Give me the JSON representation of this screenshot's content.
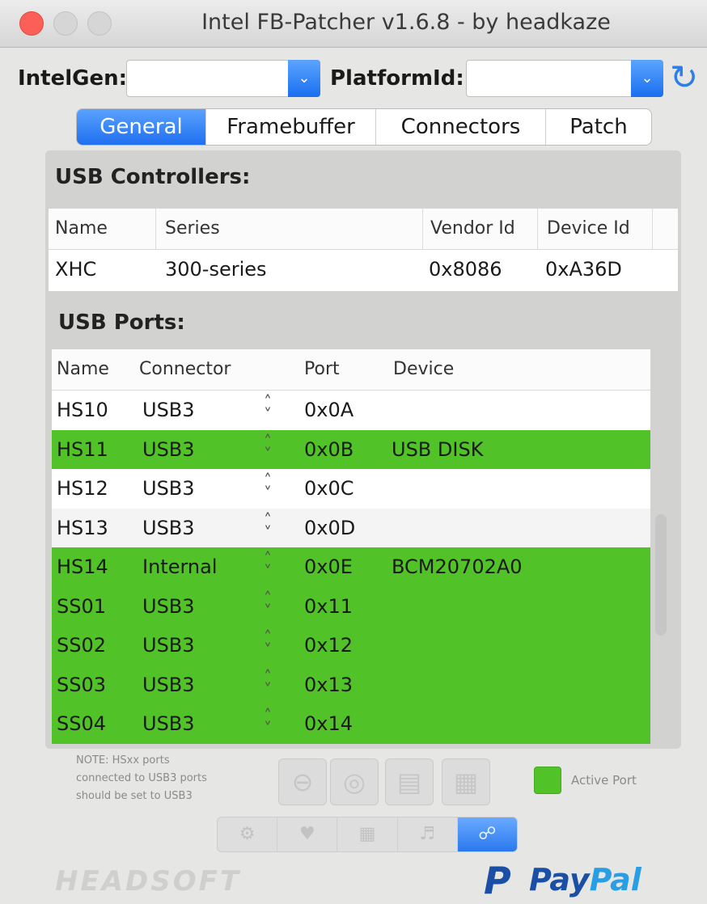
{
  "window": {
    "title": "Intel FB-Patcher v1.6.8 - by headkaze"
  },
  "toolbar_top": {
    "intelgen_label": "IntelGen:",
    "intelgen_value": "",
    "platformid_label": "PlatformId:",
    "platformid_value": ""
  },
  "tabs": [
    {
      "label": "General",
      "active": true
    },
    {
      "label": "Framebuffer",
      "active": false
    },
    {
      "label": "Connectors",
      "active": false
    },
    {
      "label": "Patch",
      "active": false
    }
  ],
  "usb_controllers": {
    "title": "USB Controllers:",
    "columns": [
      "Name",
      "Series",
      "Vendor Id",
      "Device Id"
    ],
    "rows": [
      {
        "name": "XHC",
        "series": "300-series",
        "vendor_id": "0x8086",
        "device_id": "0xA36D"
      }
    ]
  },
  "usb_ports": {
    "title": "USB Ports:",
    "columns": [
      "Name",
      "Connector",
      "Port",
      "Device"
    ],
    "rows": [
      {
        "name": "HS10",
        "connector": "USB3",
        "port": "0x0A",
        "device": "",
        "active": false
      },
      {
        "name": "HS11",
        "connector": "USB3",
        "port": "0x0B",
        "device": "USB DISK",
        "active": true
      },
      {
        "name": "HS12",
        "connector": "USB3",
        "port": "0x0C",
        "device": "",
        "active": false
      },
      {
        "name": "HS13",
        "connector": "USB3",
        "port": "0x0D",
        "device": "",
        "active": false
      },
      {
        "name": "HS14",
        "connector": "Internal",
        "port": "0x0E",
        "device": "BCM20702A0",
        "active": true
      },
      {
        "name": "SS01",
        "connector": "USB3",
        "port": "0x11",
        "device": "",
        "active": true
      },
      {
        "name": "SS02",
        "connector": "USB3",
        "port": "0x12",
        "device": "",
        "active": true
      },
      {
        "name": "SS03",
        "connector": "USB3",
        "port": "0x13",
        "device": "",
        "active": true
      },
      {
        "name": "SS04",
        "connector": "USB3",
        "port": "0x14",
        "device": "",
        "active": true
      }
    ]
  },
  "note": {
    "line1": "NOTE: HSxx ports",
    "line2": "connected to USB3 ports",
    "line3": "should be set to USB3"
  },
  "legend": {
    "label": "Active Port",
    "color": "#51c227"
  },
  "branding": {
    "headsoft": "HEADSOFT",
    "paypal_a": "Pay",
    "paypal_b": "Pal"
  },
  "colors": {
    "accent": "#1f6ff0",
    "active_row": "#51c227"
  }
}
